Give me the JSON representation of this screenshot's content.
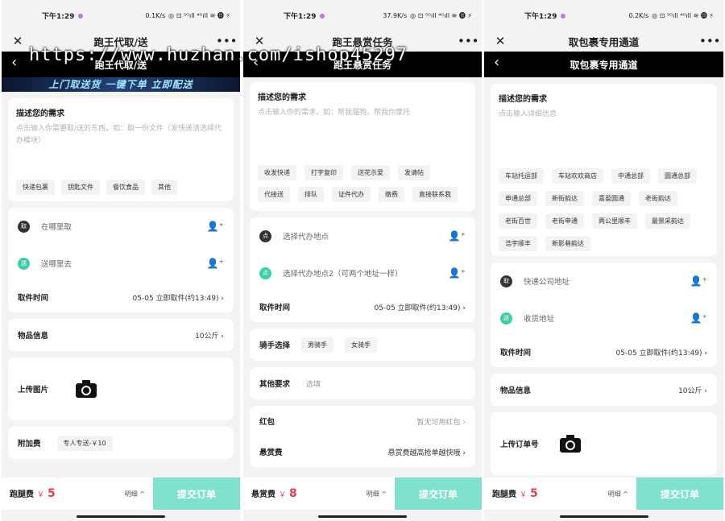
{
  "watermark": "https://www.huzhan.com/ishop45297",
  "status": {
    "p1": {
      "time": "下午1:29",
      "speed": "0.1K/s",
      "icons": "◎ ⊡ ⁵ᴳıll ⁴ᴳıll ≋ ⓫ ⚡"
    },
    "p2": {
      "time": "下午1:29",
      "speed": "37.9K/s",
      "icons": "◎ ⊡ ⁵ᴳıll ⁴ᴳıll ≋ ⓫ ⚡"
    },
    "p3": {
      "time": "下午1:29",
      "speed": "0.2K/s",
      "icons": "◎ ⊡ ⁵ᴳıll ⁴ᴳıll ≋ ⓫ ⚡"
    }
  },
  "p1": {
    "nav_title": "跑王代取/送",
    "bar_title": "跑王代取/送",
    "banner": "上门取送货 一键下单 立即配送",
    "desc_title": "描述您的需求",
    "desc_placeholder": "点击输入你需要取/送的东西，如：取一份文件（发快递请选择代办模块）",
    "tags": [
      "快递包裹",
      "钥匙文件",
      "餐饮食品",
      "其他"
    ],
    "pickup_badge": "取",
    "pickup": "在哪里取",
    "deliver_badge": "送",
    "deliver": "送哪里去",
    "time_label": "取件时间",
    "time_value": "05-05 立即取件(约13:49)",
    "goods_label": "物品信息",
    "goods_value": "10公斤",
    "upload_label": "上传图片",
    "extra_label": "附加费",
    "extra_value": "专人专送-￥10",
    "fee_label": "跑腿费",
    "fee_currency": "￥",
    "fee_amount": "5",
    "detail": "明细 ^",
    "submit": "提交订单"
  },
  "p2": {
    "nav_title": "跑王悬赏任务",
    "bar_title": "跑王悬赏任务",
    "desc_title": "描述您的需求",
    "desc_placeholder": "点击输入你的需求，如：帮我遛狗，帮我你摩托",
    "tags": [
      "收发快递",
      "打字复印",
      "送花示爱",
      "发请帖",
      "代接送",
      "排队",
      "证件代办",
      "缴费",
      "直接联系我"
    ],
    "loc1_badge": "点",
    "loc1": "选择代办地点",
    "loc2_badge": "点",
    "loc2": "选择代办地点2（可两个地址一样）",
    "time_label": "取件时间",
    "time_value": "05-05 立即取件(约13:49)",
    "rider_label": "骑手选择",
    "rider_options": [
      "男骑手",
      "女骑手"
    ],
    "other_label": "其他要求",
    "other_placeholder": "选填",
    "redpack_label": "红包",
    "redpack_value": "暂无可用红包",
    "reward_label": "悬赏费",
    "reward_value": "悬赏费越高抢单越快哦",
    "fee_label": "悬赏费",
    "fee_currency": "￥",
    "fee_amount": "8",
    "detail": "明细 ^",
    "submit": "提交订单"
  },
  "p3": {
    "nav_title": "取包裹专用通道",
    "bar_title": "取包裹专用通道",
    "desc_title": "描述您的需求",
    "desc_placeholder": "点击输入详细信息",
    "tags": [
      "车站托运部",
      "车站欢欢商店",
      "中通总部",
      "圆通总部",
      "申通总部",
      "新街韵达",
      "喜盈圆通",
      "老街韵达",
      "老街百世",
      "老街申通",
      "两公里顺丰",
      "最景采韵达",
      "浩宇顺丰",
      "新影巷韵达"
    ],
    "company_badge": "取",
    "company": "快递公司地址",
    "recv_badge": "送",
    "recv": "收货地址",
    "time_label": "取件时间",
    "time_value": "05-05 立即取件(约13:49)",
    "goods_label": "物品信息",
    "goods_value": "10公斤",
    "upload_label": "上传订单号",
    "fee_label": "跑腿费",
    "fee_currency": "￥",
    "fee_amount": "5",
    "detail": "明细 ^",
    "submit": "提交订单"
  }
}
